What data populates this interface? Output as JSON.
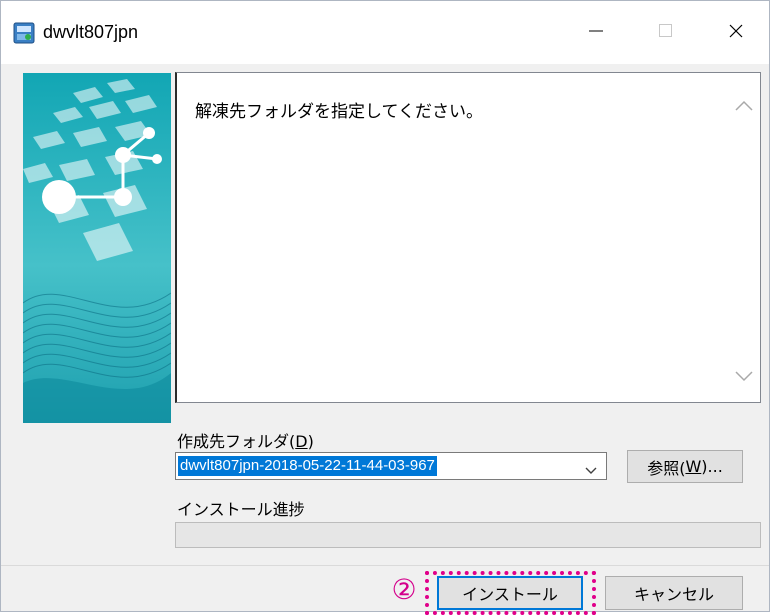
{
  "window": {
    "title": "dwvlt807jpn",
    "controls": [
      "minimize",
      "maximize",
      "close"
    ]
  },
  "message": "解凍先フォルダを指定してください。",
  "destination": {
    "label_main": "作成先フォルダ(",
    "label_key": "D",
    "label_end": ")",
    "value": "dwvlt807jpn-2018-05-22-11-44-03-967"
  },
  "browse_button": {
    "label_main": "参照(",
    "label_key": "W",
    "label_end": ")..."
  },
  "progress": {
    "label": "インストール進捗",
    "value": 0
  },
  "buttons": {
    "install": "インストール",
    "cancel": "キャンセル"
  },
  "annotation": {
    "step": "②",
    "color": "#e0008a"
  },
  "icons": {
    "app": "installer-icon",
    "minimize": "minimize-icon",
    "maximize": "maximize-icon",
    "close": "close-icon",
    "scroll_up": "chevron-up-icon",
    "scroll_down": "chevron-down-icon",
    "combo": "chevron-down-icon"
  },
  "colors": {
    "accent": "#0078d7",
    "banner_teal": "#1fa9b5"
  }
}
